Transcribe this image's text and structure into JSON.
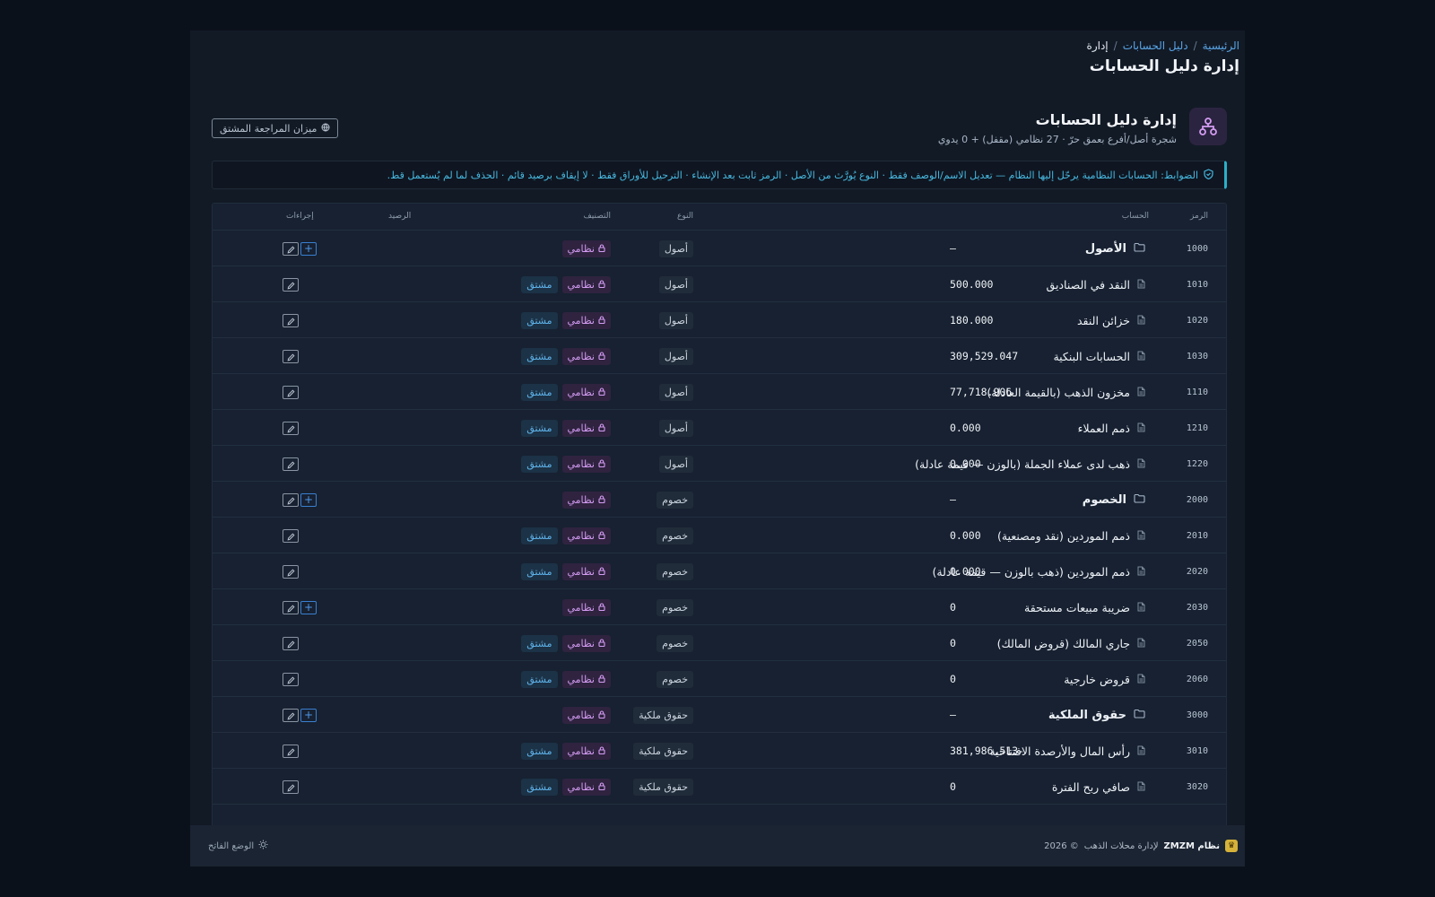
{
  "breadcrumb": {
    "home": "الرئيسية",
    "coa": "دليل الحسابات",
    "current": "إدارة",
    "sep": "/"
  },
  "page_title": "إدارة دليل الحسابات",
  "section": {
    "title": "إدارة دليل الحسابات",
    "subtitle": "شجرة أصل/أفرع بعمق حرّ · 27 نظامي (مقفل) + 0 يدوي",
    "trial_balance_button": "ميزان المراجعة المشتق"
  },
  "rules_text": "الضوابط: الحسابات النظامية يرحّل إليها النظام — تعديل الاسم/الوصف فقط · النوع يُورَّث من الأصل · الرمز ثابت بعد الإنشاء · الترحيل للأوراق فقط · لا إيقاف برصيد قائم · الحذف لما لم يُستعمل قط.",
  "columns": {
    "code": "الرمز",
    "account": "الحساب",
    "type": "النوع",
    "classification": "التصنيف",
    "balance": "الرصيد",
    "actions": "إجراءات"
  },
  "labels": {
    "system": "نظامي",
    "derived": "مشتق"
  },
  "rows": [
    {
      "code": "1000",
      "name": "الأصول",
      "type": "أصول",
      "group": true,
      "derived": false,
      "balance": "—",
      "addable": true
    },
    {
      "code": "1010",
      "name": "النقد في الصناديق",
      "type": "أصول",
      "group": false,
      "derived": true,
      "balance": "500.000",
      "addable": false
    },
    {
      "code": "1020",
      "name": "خزائن النقد",
      "type": "أصول",
      "group": false,
      "derived": true,
      "balance": "180.000",
      "addable": false
    },
    {
      "code": "1030",
      "name": "الحسابات البنكية",
      "type": "أصول",
      "group": false,
      "derived": true,
      "balance": "309,529.047",
      "addable": false
    },
    {
      "code": "1110",
      "name": "مخزون الذهب (بالقيمة العادلة)",
      "type": "أصول",
      "group": false,
      "derived": true,
      "balance": "77,718.906",
      "addable": false
    },
    {
      "code": "1210",
      "name": "ذمم العملاء",
      "type": "أصول",
      "group": false,
      "derived": true,
      "balance": "0.000",
      "addable": false
    },
    {
      "code": "1220",
      "name": "ذهب لدى عملاء الجملة (بالوزن — قيمة عادلة)",
      "type": "أصول",
      "group": false,
      "derived": true,
      "balance": "0.000",
      "addable": false
    },
    {
      "code": "2000",
      "name": "الخصوم",
      "type": "خصوم",
      "group": true,
      "derived": false,
      "balance": "—",
      "addable": true
    },
    {
      "code": "2010",
      "name": "ذمم الموردين (نقد ومصنعية)",
      "type": "خصوم",
      "group": false,
      "derived": true,
      "balance": "0.000",
      "addable": false
    },
    {
      "code": "2020",
      "name": "ذمم الموردين (ذهب بالوزن — قيمة عادلة)",
      "type": "خصوم",
      "group": false,
      "derived": true,
      "balance": "0.000",
      "addable": false
    },
    {
      "code": "2030",
      "name": "ضريبة مبيعات مستحقة",
      "type": "خصوم",
      "group": false,
      "derived": false,
      "balance": "0",
      "addable": true
    },
    {
      "code": "2050",
      "name": "جاري المالك (قروض المالك)",
      "type": "خصوم",
      "group": false,
      "derived": true,
      "balance": "0",
      "addable": false
    },
    {
      "code": "2060",
      "name": "قروض خارجية",
      "type": "خصوم",
      "group": false,
      "derived": true,
      "balance": "0",
      "addable": false
    },
    {
      "code": "3000",
      "name": "حقوق الملكية",
      "type": "حقوق ملكية",
      "group": true,
      "derived": false,
      "balance": "—",
      "addable": true
    },
    {
      "code": "3010",
      "name": "رأس المال والأرصدة الافتتاحية",
      "type": "حقوق ملكية",
      "group": false,
      "derived": true,
      "balance": "381,986.513-",
      "addable": false
    },
    {
      "code": "3020",
      "name": "صافي ربح الفترة",
      "type": "حقوق ملكية",
      "group": false,
      "derived": true,
      "balance": "0",
      "addable": false
    }
  ],
  "footer": {
    "brand_name": "نظام ZMZM",
    "brand_desc": "لإدارة محلات الذهب",
    "copyright": "© 2026",
    "theme_toggle": "الوضع الفاتح"
  },
  "colors": {
    "accent": "#5aa5e6",
    "system": "#d49cf2",
    "derived": "#5fb4ec",
    "rule": "#2bb0c9",
    "brand": "#d6b23a"
  },
  "icons": {
    "section": "hierarchy-icon",
    "trial": "globe-icon",
    "rules": "shield-icon",
    "group": "folder-icon",
    "leaf": "document-icon",
    "lock": "lock-icon",
    "edit": "pencil-icon",
    "add": "plus-icon",
    "theme": "sun-icon"
  }
}
